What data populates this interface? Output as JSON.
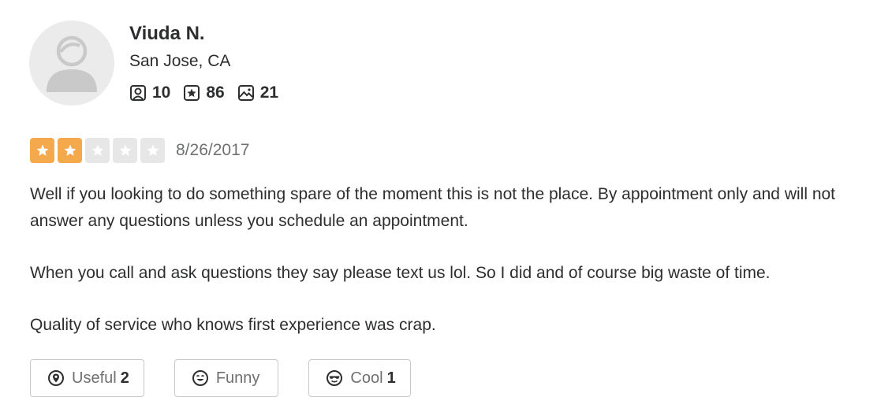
{
  "user": {
    "name": "Viuda N.",
    "location": "San Jose, CA",
    "friends": "10",
    "reviews": "86",
    "photos": "21",
    "avatar_icon": "default-user-avatar-icon"
  },
  "review": {
    "rating": 2,
    "max_rating": 5,
    "date": "8/26/2017",
    "paragraphs": [
      "Well if you looking to do something spare of the moment this is not the place. By appointment only and will not answer any questions unless you schedule an appointment.",
      "When you call and ask questions they say please text us lol. So I did and of course big waste of time.",
      "Quality of service who knows first experience was crap."
    ]
  },
  "actions": {
    "useful_label": "Useful",
    "useful_count": "2",
    "funny_label": "Funny",
    "funny_count": "",
    "cool_label": "Cool",
    "cool_count": "1"
  },
  "colors": {
    "star_filled": "#f4a94d",
    "star_empty": "#e7e7e7",
    "text": "#2d2e2f",
    "muted": "#6e7072"
  }
}
